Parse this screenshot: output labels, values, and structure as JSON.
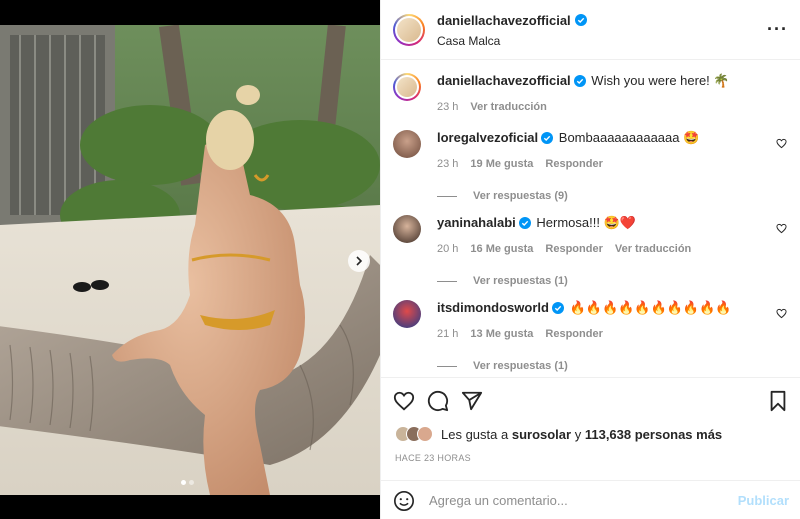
{
  "post": {
    "username": "daniellachavezofficial",
    "location": "Casa Malca",
    "caption": "Wish you were here! 🌴",
    "caption_time": "23 h",
    "see_translation": "Ver traducción"
  },
  "comments": [
    {
      "username": "loregalvezoficial",
      "text": "Bombaaaaaaaaaaaa 🤩",
      "time": "23 h",
      "likes": "19 Me gusta",
      "reply": "Responder",
      "translation": "",
      "view_replies": "Ver respuestas (9)"
    },
    {
      "username": "yaninahalabi",
      "text": "Hermosa!!! 🤩❤️",
      "time": "20 h",
      "likes": "16 Me gusta",
      "reply": "Responder",
      "translation": "Ver traducción",
      "view_replies": "Ver respuestas (1)"
    },
    {
      "username": "itsdimondosworld",
      "text": "🔥🔥🔥🔥🔥🔥🔥🔥🔥🔥",
      "time": "21 h",
      "likes": "13 Me gusta",
      "reply": "Responder",
      "translation": "",
      "view_replies": "Ver respuestas (1)"
    }
  ],
  "likes": {
    "prefix": "Les gusta a",
    "first_user": "surosolar",
    "connector": "y",
    "others": "113,638 personas más"
  },
  "time_ago": "HACE 23 HORAS",
  "add_comment": {
    "placeholder": "Agrega un comentario...",
    "publish_label": "Publicar"
  },
  "icons": {
    "heart": "heart-icon",
    "comment": "comment-icon",
    "share": "paper-plane-icon",
    "save": "bookmark-icon",
    "emoji": "emoji-icon",
    "more": "more-icon",
    "next": "chevron-right-icon"
  },
  "colors": {
    "verified": "#0095f6",
    "publish_disabled": "#b2dffc",
    "muted": "#8e8e8e",
    "text": "#262626"
  },
  "carousel": {
    "total": 2,
    "current": 1
  }
}
